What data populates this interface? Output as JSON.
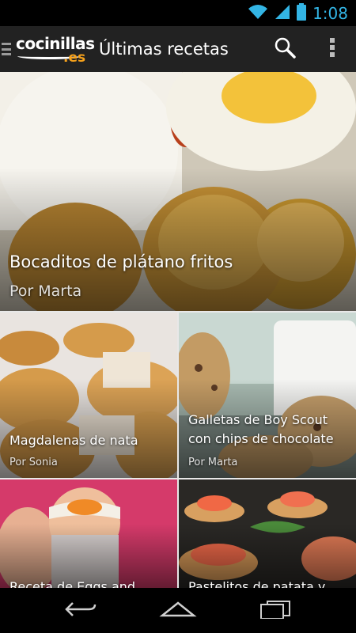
{
  "status_bar": {
    "time": "1:08",
    "icons": [
      "wifi-icon",
      "signal-icon",
      "battery-icon"
    ],
    "accent_color": "#33b5e5"
  },
  "action_bar": {
    "logo_text": "cocinillas",
    "logo_suffix": ".es",
    "title": "Últimas recetas",
    "actions": [
      "search-icon",
      "overflow-menu-icon"
    ]
  },
  "recipes": [
    {
      "title": "Bocaditos de plátano fritos",
      "author": "Por Marta"
    },
    {
      "title": "Magdalenas de nata",
      "author": "Por Sonia"
    },
    {
      "title": "Galletas de Boy Scout con chips de chocolate",
      "author": "Por Marta"
    },
    {
      "title": "Receta de Eggs and...",
      "author": ""
    },
    {
      "title": "Pastelitos de patata y...",
      "author": ""
    }
  ],
  "nav_bar": {
    "buttons": [
      "back-icon",
      "home-icon",
      "recent-apps-icon"
    ]
  }
}
